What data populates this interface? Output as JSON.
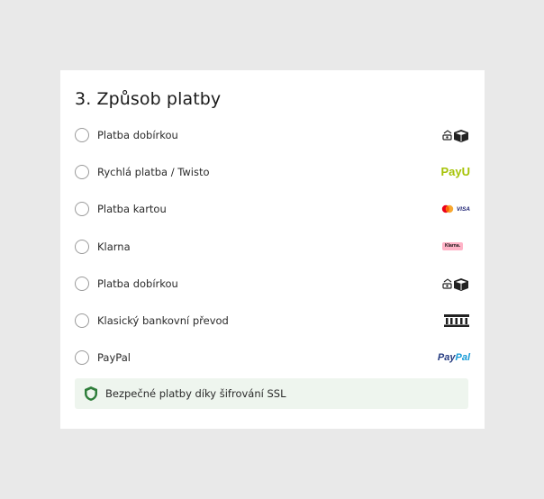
{
  "section": {
    "title": "3. Způsob platby"
  },
  "payment_options": [
    {
      "label": "Platba dobírkou",
      "icon": "cash-on-delivery-icon",
      "selected": false
    },
    {
      "label": "Rychlá platba / Twisto",
      "icon": "payu-logo",
      "logo_text": "PayU",
      "selected": false
    },
    {
      "label": "Platba kartou",
      "icon": "mastercard-visa-icon",
      "logo_text": "VISA",
      "selected": false
    },
    {
      "label": "Klarna",
      "icon": "klarna-logo",
      "logo_text": "Klarna.",
      "selected": false
    },
    {
      "label": "Platba dobírkou",
      "icon": "cash-on-delivery-icon",
      "selected": false
    },
    {
      "label": "Klasický bankovní převod",
      "icon": "bank-icon",
      "selected": false
    },
    {
      "label": "PayPal",
      "icon": "paypal-logo",
      "logo_text_a": "Pay",
      "logo_text_b": "Pal",
      "selected": false
    }
  ],
  "ssl_notice": {
    "text": "Bezpečné platby díky šifrování SSL",
    "icon": "shield-icon"
  },
  "colors": {
    "page_bg": "#e9e9e9",
    "card_bg": "#ffffff",
    "ssl_bg": "#eef5ee",
    "payu_green": "#a6c307",
    "paypal_blue": "#253b80",
    "paypal_light": "#179bd7",
    "klarna_pink": "#ffb3c7",
    "shield_green": "#2e7d3a"
  }
}
